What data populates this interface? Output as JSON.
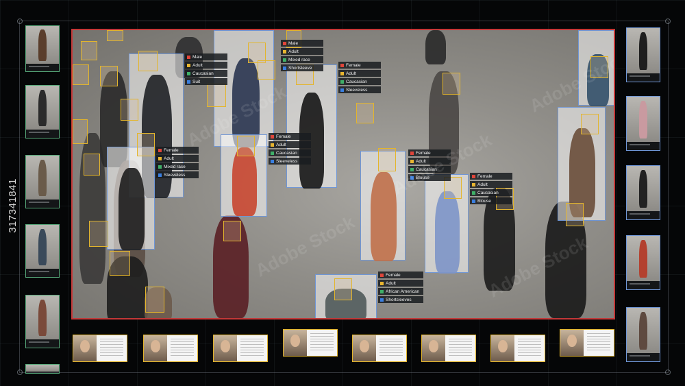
{
  "stock_id": "317341841",
  "watermark_text": "Adobe Stock",
  "tags": [
    {
      "id": "t1",
      "items": [
        {
          "label": "Male",
          "color": "#e0453a"
        },
        {
          "label": "Adult",
          "color": "#e8b530"
        },
        {
          "label": "Caucasian",
          "color": "#3fb068"
        },
        {
          "label": "Suit",
          "color": "#3a7fe0"
        }
      ]
    },
    {
      "id": "t2",
      "items": [
        {
          "label": "Male",
          "color": "#e0453a"
        },
        {
          "label": "Adult",
          "color": "#e8b530"
        },
        {
          "label": "Mixed race",
          "color": "#3fb068"
        },
        {
          "label": "Shortsleeve",
          "color": "#3a7fe0"
        }
      ]
    },
    {
      "id": "t3",
      "items": [
        {
          "label": "Female",
          "color": "#e0453a"
        },
        {
          "label": "Adult",
          "color": "#e8b530"
        },
        {
          "label": "Caucasian",
          "color": "#3fb068"
        },
        {
          "label": "Sleeveless",
          "color": "#3a7fe0"
        }
      ]
    },
    {
      "id": "t4",
      "items": [
        {
          "label": "Female",
          "color": "#e0453a"
        },
        {
          "label": "Adult",
          "color": "#e8b530"
        },
        {
          "label": "Caucasian",
          "color": "#3fb068"
        },
        {
          "label": "Sleeveless",
          "color": "#3a7fe0"
        }
      ]
    },
    {
      "id": "t5",
      "items": [
        {
          "label": "Female",
          "color": "#e0453a"
        },
        {
          "label": "Adult",
          "color": "#e8b530"
        },
        {
          "label": "Mixed race",
          "color": "#3fb068"
        },
        {
          "label": "Sleeveless",
          "color": "#3a7fe0"
        }
      ]
    },
    {
      "id": "t6",
      "items": [
        {
          "label": "Female",
          "color": "#e0453a"
        },
        {
          "label": "Adult",
          "color": "#e8b530"
        },
        {
          "label": "Caucasian",
          "color": "#3fb068"
        },
        {
          "label": "Blouse",
          "color": "#3a7fe0"
        }
      ]
    },
    {
      "id": "t7",
      "items": [
        {
          "label": "Female",
          "color": "#e0453a"
        },
        {
          "label": "Adult",
          "color": "#e8b530"
        },
        {
          "label": "Caucasian",
          "color": "#3fb068"
        },
        {
          "label": "Blouse",
          "color": "#3a7fe0"
        }
      ]
    },
    {
      "id": "t8",
      "items": [
        {
          "label": "Female",
          "color": "#e0453a"
        },
        {
          "label": "Adult",
          "color": "#e8b530"
        },
        {
          "label": "African American",
          "color": "#3fb068"
        },
        {
          "label": "Shortsleeves",
          "color": "#3a7fe0"
        }
      ]
    }
  ]
}
